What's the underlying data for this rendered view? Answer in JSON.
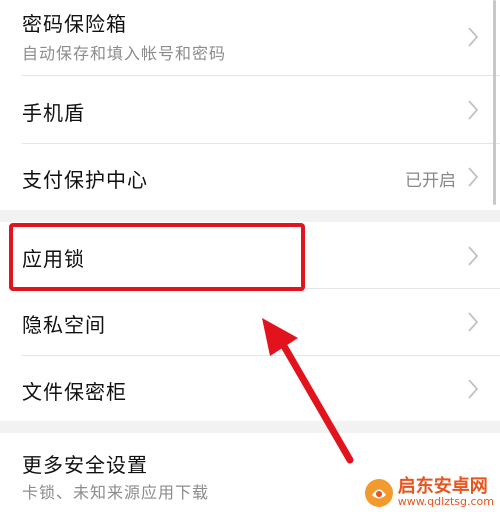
{
  "items": [
    {
      "title": "密码保险箱",
      "subtitle": "自动保存和填入帐号和密码"
    },
    {
      "title": "手机盾"
    },
    {
      "title": "支付保护中心",
      "status": "已开启"
    },
    {
      "title": "应用锁"
    },
    {
      "title": "隐私空间"
    },
    {
      "title": "文件保密柜"
    },
    {
      "title": "更多安全设置",
      "subtitle": "卡锁、未知来源应用下载"
    }
  ],
  "watermark": {
    "name": "启东安卓网",
    "url": "www.qdlztsg.com"
  },
  "colors": {
    "highlight": "#e3131e",
    "arrow": "#e3131e",
    "watermark": "#e8541e"
  }
}
